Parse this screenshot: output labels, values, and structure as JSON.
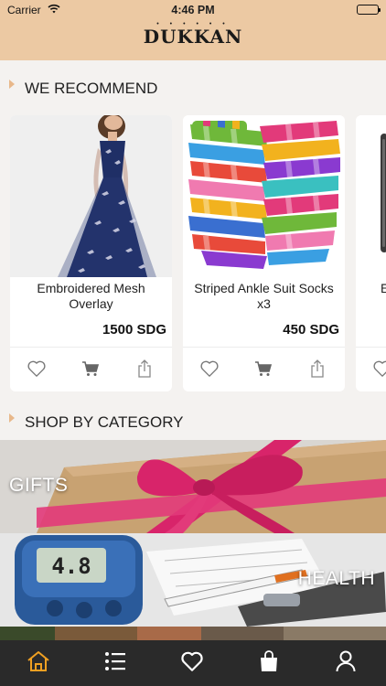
{
  "status": {
    "carrier": "Carrier",
    "time": "4:46 PM"
  },
  "app": {
    "logo": "DUKKAN",
    "logo_dots": "• • • • • •"
  },
  "sections": {
    "recommend": "WE RECOMMEND",
    "category": "SHOP BY CATEGORY"
  },
  "products": [
    {
      "name": "Embroidered Mesh Overlay",
      "price": "1500 SDG"
    },
    {
      "name": "Striped Ankle Suit Socks x3",
      "price": "450 SDG"
    },
    {
      "name": "E",
      "price": ""
    }
  ],
  "categories": [
    {
      "label": "GIFTS"
    },
    {
      "label": "HEALTH"
    },
    {
      "label": ""
    }
  ],
  "glucometer_reading": "4.8",
  "tabs": [
    {
      "icon": "home-icon",
      "active": true
    },
    {
      "icon": "list-icon",
      "active": false
    },
    {
      "icon": "heart-icon",
      "active": false
    },
    {
      "icon": "shopping-bag-icon",
      "active": false
    },
    {
      "icon": "user-icon",
      "active": false
    }
  ],
  "colors": {
    "header": "#ecc9a3",
    "tabbar": "#2a2a2a",
    "tab_active": "#f0a022",
    "tab_inactive": "#ffffff",
    "dress": "#1f2f66",
    "ribbon": "#d8246a"
  }
}
